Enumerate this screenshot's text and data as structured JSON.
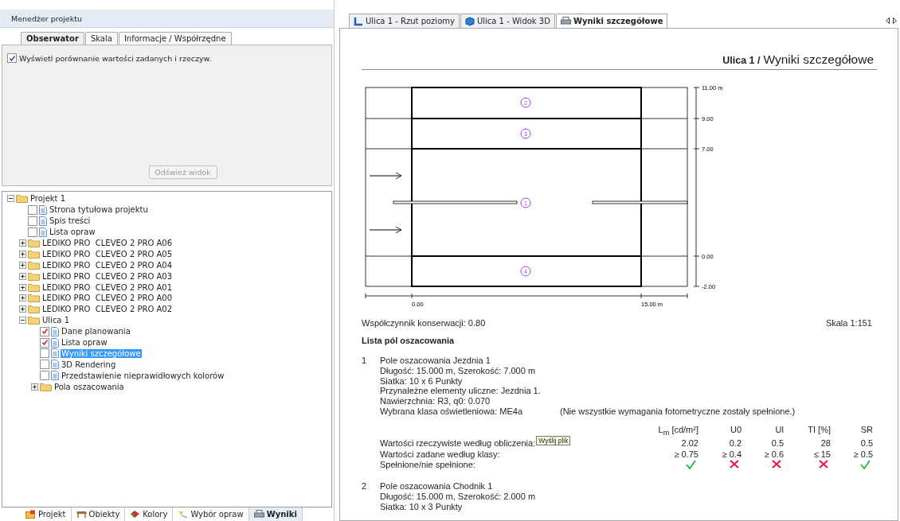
{
  "project_manager": {
    "title": "Menedżer projektu",
    "tabs": [
      {
        "label": "Obserwator",
        "selected": true
      },
      {
        "label": "Skala",
        "selected": false
      },
      {
        "label": "Informacje / Współrzędne",
        "selected": false
      }
    ],
    "option": {
      "label": "Wyświetl porównanie wartości zadanych i rzeczyw.",
      "checked": true
    },
    "refresh_button": {
      "label": "Odśwież widok",
      "disabled": true
    }
  },
  "tree": [
    {
      "label": "Projekt 1",
      "kind": "folder",
      "expanded": true,
      "selected": false,
      "children": [
        {
          "label": "Strona tytułowa projektu",
          "kind": "document",
          "checked": false,
          "selected": false
        },
        {
          "label": "Spis treści",
          "kind": "document",
          "checked": false,
          "selected": false
        },
        {
          "label": "Lista opraw",
          "kind": "document",
          "checked": false,
          "selected": false
        },
        {
          "label": "LEDIKO PRO  CLEVEO 2 PRO A06",
          "kind": "folder",
          "expanded": false,
          "selected": false
        },
        {
          "label": "LEDIKO PRO  CLEVEO 2 PRO A05",
          "kind": "folder",
          "expanded": false,
          "selected": false
        },
        {
          "label": "LEDIKO PRO  CLEVEO 2 PRO A04",
          "kind": "folder",
          "expanded": false,
          "selected": false
        },
        {
          "label": "LEDIKO PRO  CLEVEO 2 PRO A03",
          "kind": "folder",
          "expanded": false,
          "selected": false
        },
        {
          "label": "LEDIKO PRO  CLEVEO 2 PRO A01",
          "kind": "folder",
          "expanded": false,
          "selected": false
        },
        {
          "label": "LEDIKO PRO  CLEVEO 2 PRO A00",
          "kind": "folder",
          "expanded": false,
          "selected": false
        },
        {
          "label": "LEDIKO PRO  CLEVEO 2 PRO A02",
          "kind": "folder",
          "expanded": false,
          "selected": false
        },
        {
          "label": "Ulica 1",
          "kind": "folder",
          "expanded": true,
          "selected": false,
          "children": [
            {
              "label": "Dane planowania",
              "kind": "document",
              "checked": true,
              "selected": false
            },
            {
              "label": "Lista opraw",
              "kind": "document",
              "checked": true,
              "selected": false
            },
            {
              "label": "Wyniki szczegółowe",
              "kind": "document",
              "checked": false,
              "selected": true
            },
            {
              "label": "3D Rendering",
              "kind": "document",
              "checked": false,
              "selected": false
            },
            {
              "label": "Przedstawienie nieprawidłowych kolorów",
              "kind": "document",
              "checked": false,
              "selected": false
            },
            {
              "label": "Pola oszacowania",
              "kind": "folder",
              "expanded": false,
              "selected": false
            }
          ]
        }
      ]
    }
  ],
  "bottom_tabs": [
    {
      "label": "Projekt",
      "selected": false
    },
    {
      "label": "Obiekty",
      "selected": false
    },
    {
      "label": "Kolory",
      "selected": false
    },
    {
      "label": "Wybór opraw",
      "selected": false
    },
    {
      "label": "Wyniki",
      "selected": true
    }
  ],
  "document_tabs": [
    {
      "label": "Ulica 1 - Rzut poziomy",
      "selected": false
    },
    {
      "label": "Ulica 1 - Widok 3D",
      "selected": false
    },
    {
      "label": "Wyniki szczegółowe",
      "selected": true
    }
  ],
  "report": {
    "breadcrumb": "Ulica 1 /",
    "title": "Wyniki szczegółowe",
    "plan": {
      "fields": [
        "2",
        "3",
        "1",
        "4"
      ],
      "y_labels": [
        "11.00 m",
        "9.00",
        "7.00",
        "0.00",
        "-2.00"
      ],
      "x_labels": [
        "0.00",
        "15.00 m"
      ]
    },
    "maintenance": "Współczynnik konserwacji: 0.80",
    "scale": "Skala 1:151",
    "section_title": "Lista pól oszacowania",
    "fields": [
      {
        "number": "1",
        "lines": [
          "Pole oszacowania Jezdnia 1",
          "Długość: 15.000 m, Szerokość: 7.000 m",
          "Siatka: 10 x 6 Punkty",
          "Przynależne elementy uliczne: Jezdnia 1.",
          "Nawierzchnia: R3, q0: 0.070",
          "Wybrana klasa oświetleniowa: ME4a"
        ],
        "note": "(Nie wszystkie wymagania fotometryczne zostały spełnione.)",
        "results": {
          "columns": [
            "L$_{m}$ [cd/m²]",
            "U0",
            "Ul",
            "TI [%]",
            "SR"
          ],
          "rows": [
            {
              "label": "Wartości rzeczywiste według obliczenia:",
              "values": [
                "2.02",
                "0.2",
                "0.5",
                "28",
                "0.5"
              ]
            },
            {
              "label": "Wartości zadane według klasy:",
              "values": [
                "≥ 0.75",
                "≥ 0.4",
                "≥ 0.6",
                "≤ 15",
                "≥ 0.5"
              ]
            }
          ],
          "compliance": {
            "label": "Spełnione/nie spełnione:",
            "results": [
              {
                "met": true
              },
              {
                "met": false
              },
              {
                "met": false
              },
              {
                "met": false
              },
              {
                "met": true
              }
            ]
          },
          "tooltip": "Wyślij plik"
        }
      },
      {
        "number": "2",
        "lines": [
          "Pole oszacowania Chodnik 1",
          "Długość: 15.000 m, Szerokość: 2.000 m",
          "Siatka: 10 x 3 Punkty"
        ]
      }
    ]
  }
}
